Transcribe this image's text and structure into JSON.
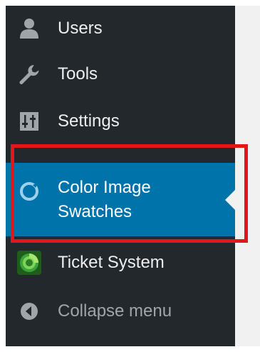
{
  "sidebar": {
    "items": [
      {
        "label": "Users",
        "icon": "users-icon"
      },
      {
        "label": "Tools",
        "icon": "wrench-icon"
      },
      {
        "label": "Settings",
        "icon": "settings-sliders-icon"
      },
      {
        "label": "Color Image Swatches",
        "label_line1": "Color Image",
        "label_line2": "Swatches",
        "icon": "swatches-icon",
        "active": true
      },
      {
        "label": "Ticket System",
        "icon": "ticket-system-icon"
      },
      {
        "label": "Collapse menu",
        "icon": "collapse-arrow-icon"
      }
    ]
  },
  "colors": {
    "sidebar_bg": "#23282d",
    "active_bg": "#0073aa",
    "highlight_border": "#e3161b",
    "collapse_text": "#a0a5aa"
  }
}
